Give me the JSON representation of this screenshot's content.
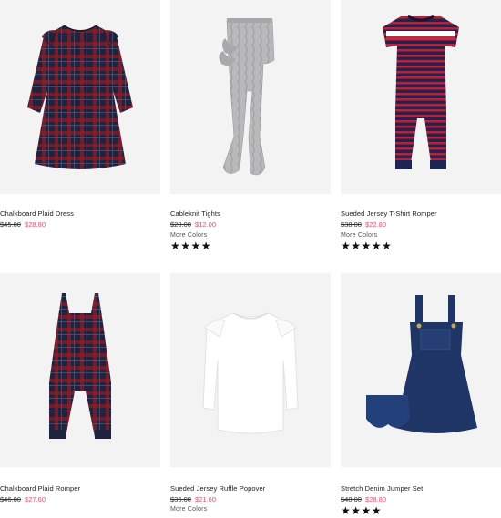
{
  "products": [
    {
      "name": "Chalkboard Plaid Dress",
      "old_price": "$45.00",
      "sale_price": "$28.80",
      "more_colors": "",
      "stars": ""
    },
    {
      "name": "Cableknit Tights",
      "old_price": "$20.00",
      "sale_price": "$12.00",
      "more_colors": "More Colors",
      "stars": "★★★★"
    },
    {
      "name": "Sueded Jersey T-Shirt Romper",
      "old_price": "$38.00",
      "sale_price": "$22.80",
      "more_colors": "More Colors",
      "stars": "★★★★★"
    },
    {
      "name": "Chalkboard Plaid Romper",
      "old_price": "$46.00",
      "sale_price": "$27.60",
      "more_colors": "",
      "stars": ""
    },
    {
      "name": "Sueded Jersey Ruffle Popover",
      "old_price": "$36.00",
      "sale_price": "$21.60",
      "more_colors": "More Colors",
      "stars": ""
    },
    {
      "name": "Stretch Denim Jumper Set",
      "old_price": "$48.00",
      "sale_price": "$28.80",
      "more_colors": "",
      "stars": "★★★★"
    }
  ],
  "colors": {
    "sale": "#e2566b",
    "image_bg": "#f3f3f3",
    "plaid_navy": "#1f2340",
    "plaid_red": "#8a1f2a",
    "tights_gray": "#b9b9bb",
    "romper_navy": "#1c2554",
    "romper_red": "#b6243a",
    "denim": "#1e3566"
  }
}
